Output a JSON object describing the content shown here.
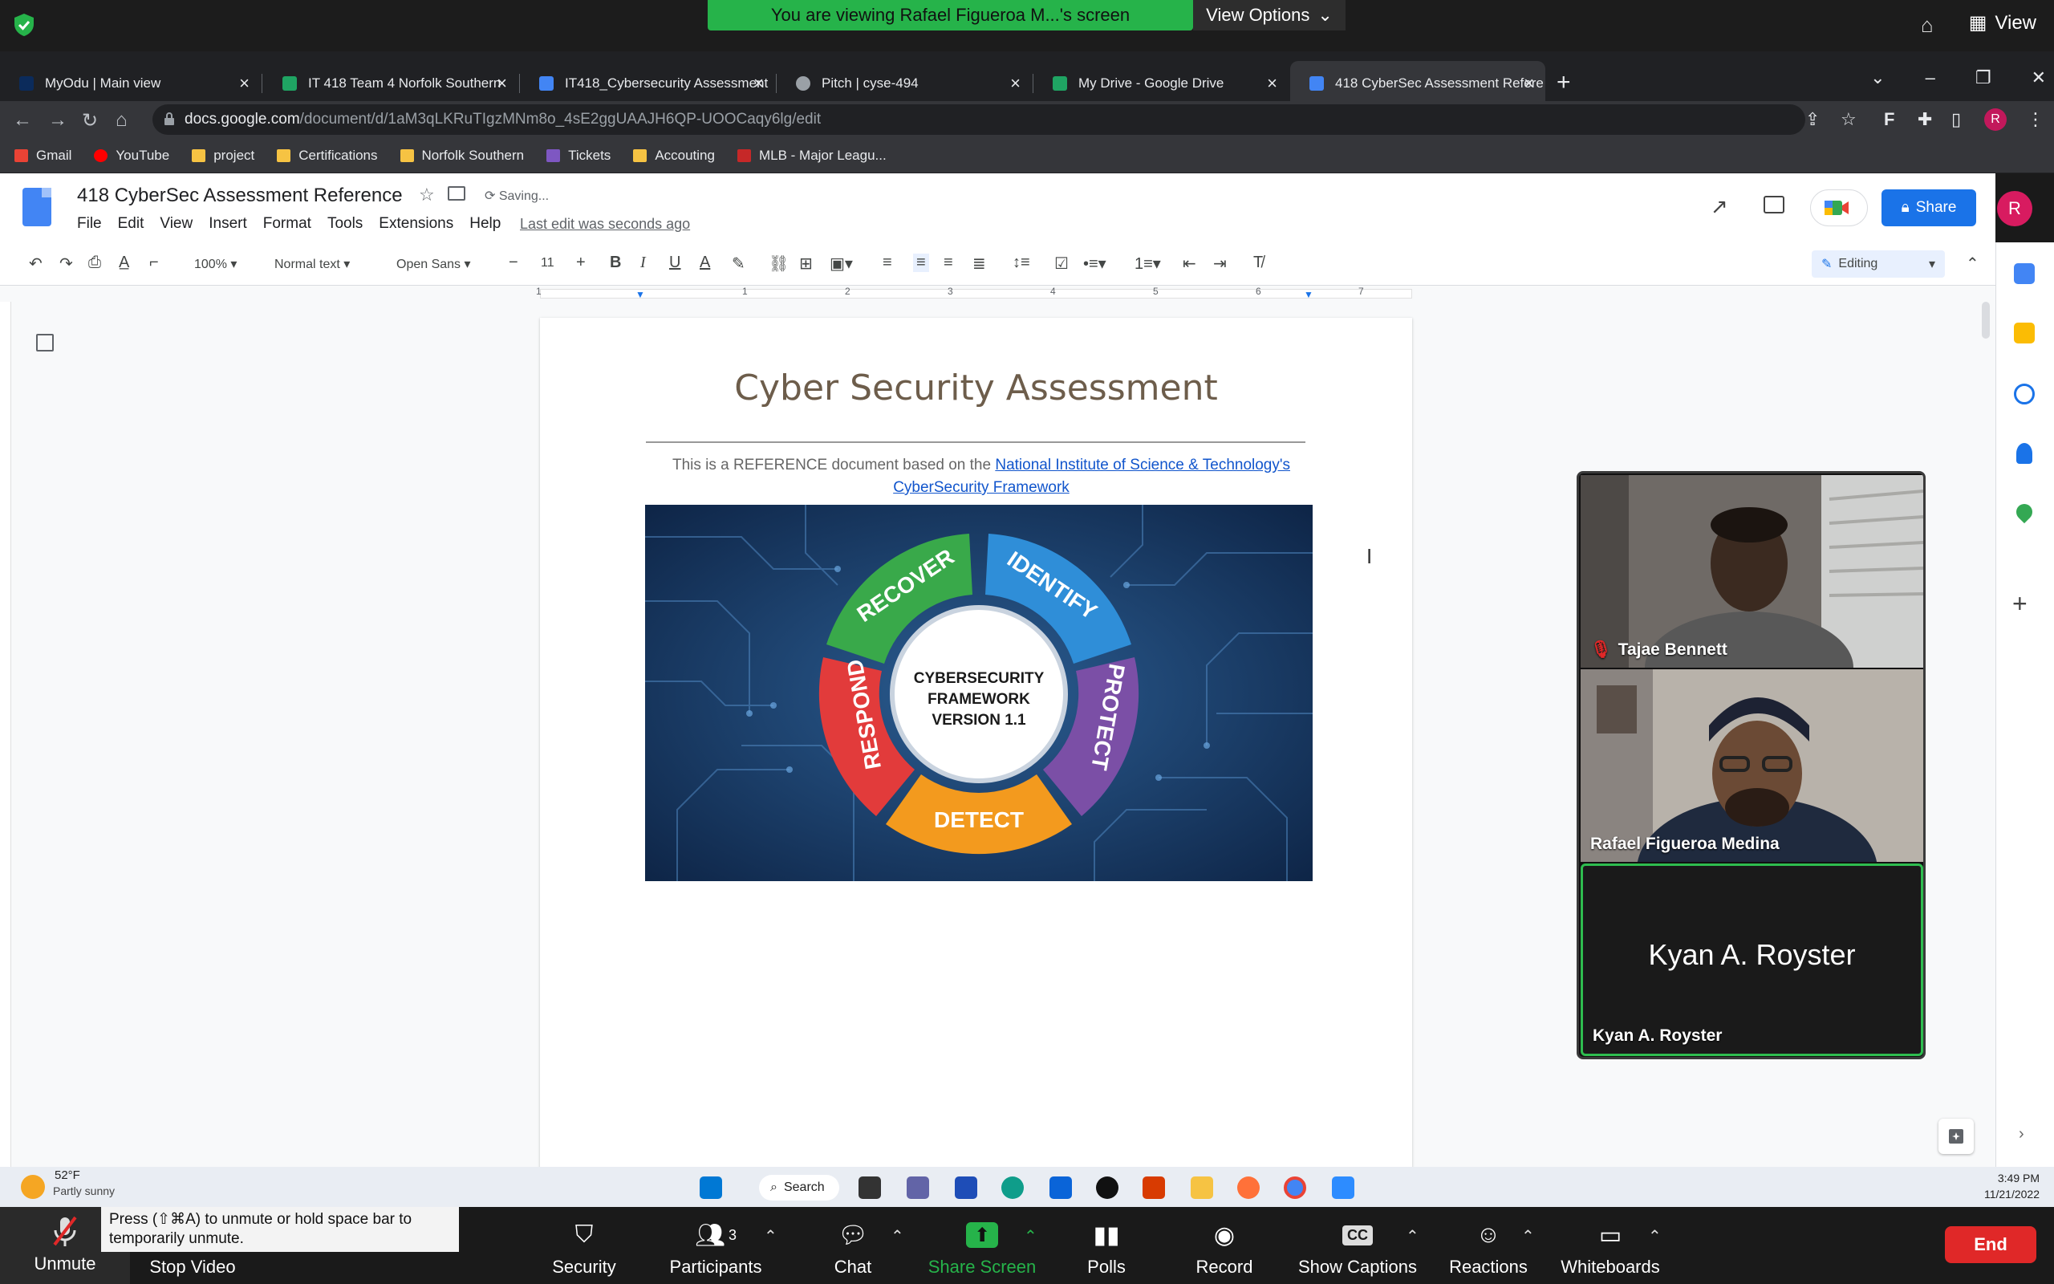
{
  "zoom_top": {
    "banner": "You are viewing Rafael Figueroa M...'s screen",
    "view_options": "View Options",
    "view": "View"
  },
  "chrome": {
    "tabs": [
      {
        "label": "MyOdu | Main view",
        "color": "#0b2b5b"
      },
      {
        "label": "IT 418 Team 4 Norfolk Southern",
        "color": "#1fa463"
      },
      {
        "label": "IT418_Cybersecurity Assessment",
        "color": "#4285f4"
      },
      {
        "label": "Pitch | cyse-494",
        "color": "#9aa0a6"
      },
      {
        "label": "My Drive - Google Drive",
        "color": "#1fa463"
      },
      {
        "label": "418 CyberSec Assessment Refere",
        "color": "#4285f4"
      }
    ],
    "url_main": "docs.google.com",
    "url_path": "/document/d/1aM3qLKRuTIgzMNm8o_4sE2ggUAAJH6QP-UOOCaqy6lg/edit",
    "profile_initial": "R",
    "bookmarks": [
      {
        "label": "Gmail",
        "color": "#ea4335"
      },
      {
        "label": "YouTube",
        "color": "#ff0000"
      },
      {
        "label": "project",
        "color": "#f6c343"
      },
      {
        "label": "Certifications",
        "color": "#f6c343"
      },
      {
        "label": "Norfolk Southern",
        "color": "#f6c343"
      },
      {
        "label": "Tickets",
        "color": "#7e57c2"
      },
      {
        "label": "Accouting",
        "color": "#f6c343"
      },
      {
        "label": "MLB - Major Leagu...",
        "color": "#c62828"
      }
    ]
  },
  "docs": {
    "title": "418 CyberSec Assessment Reference",
    "saving": "Saving...",
    "menu": [
      "File",
      "Edit",
      "View",
      "Insert",
      "Format",
      "Tools",
      "Extensions",
      "Help"
    ],
    "last_edit": "Last edit was seconds ago",
    "share": "Share",
    "account_initial": "R",
    "toolbar": {
      "zoom": "100%",
      "style": "Normal text",
      "font": "Open Sans",
      "font_size": "11",
      "editing": "Editing"
    },
    "ruler_numbers": [
      "1",
      "1",
      "2",
      "3",
      "4",
      "5",
      "6",
      "7"
    ],
    "page": {
      "heading": "Cyber Security Assessment",
      "intro_prefix": "This is a REFERENCE document based on the ",
      "intro_link1": "National Institute of Science & Technology's",
      "intro_link2": "CyberSecurity Framework"
    },
    "figure": {
      "center_line1": "CYBERSECURITY",
      "center_line2": "FRAMEWORK",
      "center_line3": "VERSION 1.1",
      "segments": [
        {
          "label": "IDENTIFY",
          "color": "#2f8ed8"
        },
        {
          "label": "PROTECT",
          "color": "#7b4fa6"
        },
        {
          "label": "DETECT",
          "color": "#f39a1e"
        },
        {
          "label": "RESPOND",
          "color": "#e23b3b"
        },
        {
          "label": "RECOVER",
          "color": "#39a94a"
        }
      ]
    }
  },
  "gallery": {
    "participants": [
      {
        "name": "Tajae Bennett"
      },
      {
        "name": "Rafael Figueroa Medina"
      },
      {
        "name": "Kyan A. Royster",
        "big_name": "Kyan A. Royster"
      }
    ]
  },
  "taskbar": {
    "temp": "52°F",
    "desc": "Partly sunny",
    "search": "Search",
    "time": "3:49 PM",
    "date": "11/21/2022"
  },
  "zoom_bar": {
    "unmute": "Unmute",
    "stop_video": "Stop Video",
    "tip": "Press  (⇧⌘A) to unmute or hold space bar to temporarily unmute.",
    "security": "Security",
    "participants": "Participants",
    "participants_count": "3",
    "chat": "Chat",
    "share_screen": "Share Screen",
    "polls": "Polls",
    "record": "Record",
    "cc": "CC",
    "show_captions": "Show Captions",
    "reactions": "Reactions",
    "whiteboards": "Whiteboards",
    "end": "End",
    "accent": "#26b34a"
  }
}
